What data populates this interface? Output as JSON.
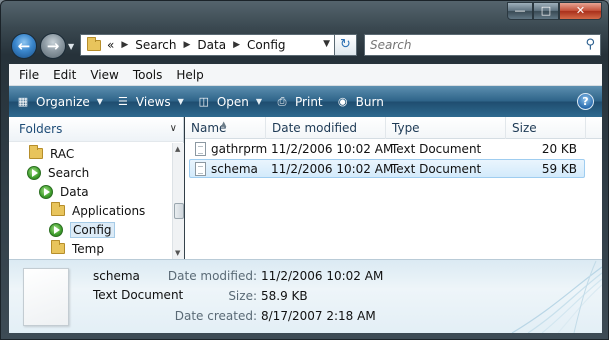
{
  "window": {
    "caption_buttons": [
      "minimize",
      "maximize",
      "close"
    ]
  },
  "address_bar": {
    "prefix": "«",
    "crumbs": [
      "Search",
      "Data",
      "Config"
    ]
  },
  "search": {
    "placeholder": "Search"
  },
  "menu": [
    "File",
    "Edit",
    "View",
    "Tools",
    "Help"
  ],
  "toolbar": {
    "organize": "Organize",
    "views": "Views",
    "open": "Open",
    "print": "Print",
    "burn": "Burn",
    "help": "?"
  },
  "nav_pane": {
    "title": "Folders",
    "items": [
      {
        "label": "RAC",
        "icon": "folder-icon"
      },
      {
        "label": "Search",
        "icon": "green-arrow-icon"
      },
      {
        "label": "Data",
        "icon": "green-arrow-icon"
      },
      {
        "label": "Applications",
        "icon": "folder-icon"
      },
      {
        "label": "Config",
        "icon": "green-arrow-icon",
        "selected": true
      },
      {
        "label": "Temp",
        "icon": "folder-icon"
      }
    ]
  },
  "file_list": {
    "columns": [
      "Name",
      "Date modified",
      "Type",
      "Size"
    ],
    "rows": [
      {
        "name": "gathrprm",
        "modified": "11/2/2006 10:02 AM",
        "type": "Text Document",
        "size": "20 KB"
      },
      {
        "name": "schema",
        "modified": "11/2/2006 10:02 AM",
        "type": "Text Document",
        "size": "59 KB",
        "selected": true
      }
    ]
  },
  "details": {
    "name": "schema",
    "type": "Text Document",
    "modified_label": "Date modified:",
    "modified": "11/2/2006 10:02 AM",
    "size_label": "Size:",
    "size": "58.9 KB",
    "created_label": "Date created:",
    "created": "8/17/2007 2:18 AM"
  },
  "colors": {
    "toolbar_blue": "#2f6489",
    "selection": "#d3eafb",
    "details_bg": "#e3eff6"
  }
}
